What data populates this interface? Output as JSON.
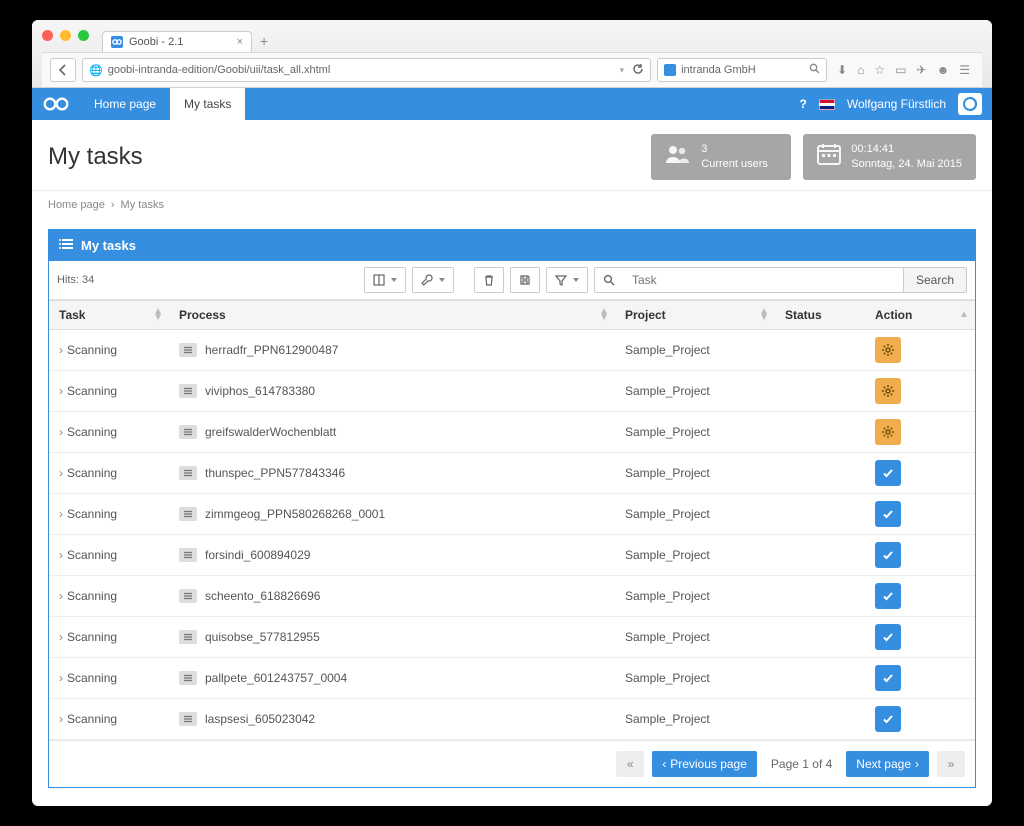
{
  "browser": {
    "tab_title": "Goobi - 2.1",
    "url": "goobi-intranda-edition/Goobi/uii/task_all.xhtml",
    "search_placeholder": "intranda GmbH"
  },
  "header": {
    "nav": {
      "home": "Home page",
      "mytasks": "My tasks"
    },
    "username": "Wolfgang Fürstlich"
  },
  "cards": {
    "users_count": "3",
    "users_label": "Current users",
    "time": "00:14:41",
    "date": "Sonntag, 24. Mai 2015"
  },
  "page": {
    "title": "My tasks",
    "crumb_home": "Home page",
    "crumb_here": "My tasks"
  },
  "panel": {
    "title": "My tasks",
    "hits": "Hits: 34",
    "search_placeholder": "Task",
    "search_button": "Search",
    "columns": {
      "task": "Task",
      "process": "Process",
      "project": "Project",
      "status": "Status",
      "action": "Action"
    },
    "rows": [
      {
        "task": "Scanning",
        "process": "herradfr_PPN612900487",
        "project": "Sample_Project",
        "action": "gear"
      },
      {
        "task": "Scanning",
        "process": "viviphos_614783380",
        "project": "Sample_Project",
        "action": "gear"
      },
      {
        "task": "Scanning",
        "process": "greifswalderWochenblatt",
        "project": "Sample_Project",
        "action": "gear"
      },
      {
        "task": "Scanning",
        "process": "thunspec_PPN577843346",
        "project": "Sample_Project",
        "action": "check"
      },
      {
        "task": "Scanning",
        "process": "zimmgeog_PPN580268268_0001",
        "project": "Sample_Project",
        "action": "check"
      },
      {
        "task": "Scanning",
        "process": "forsindi_600894029",
        "project": "Sample_Project",
        "action": "check"
      },
      {
        "task": "Scanning",
        "process": "scheento_618826696",
        "project": "Sample_Project",
        "action": "check"
      },
      {
        "task": "Scanning",
        "process": "quisobse_577812955",
        "project": "Sample_Project",
        "action": "check"
      },
      {
        "task": "Scanning",
        "process": "pallpete_601243757_0004",
        "project": "Sample_Project",
        "action": "check"
      },
      {
        "task": "Scanning",
        "process": "laspsesi_605023042",
        "project": "Sample_Project",
        "action": "check"
      }
    ],
    "pager": {
      "prev": "Previous page",
      "next": "Next page",
      "info": "Page 1 of 4"
    }
  }
}
